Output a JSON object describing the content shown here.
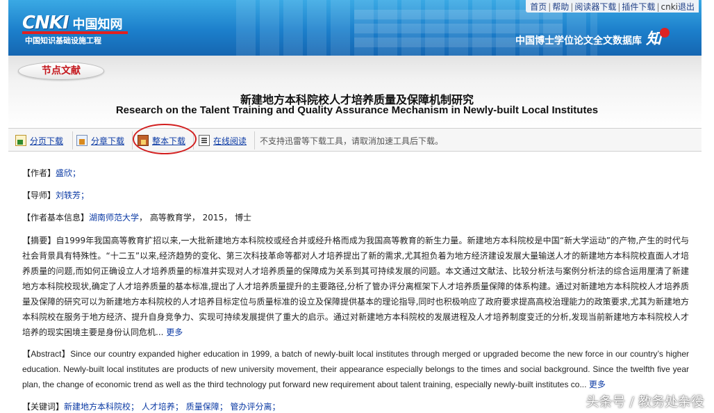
{
  "top_nav": {
    "items": [
      "首页",
      "帮助",
      "阅读器下载",
      "插件下载"
    ],
    "user": "cnki",
    "logout": "退出"
  },
  "logo": {
    "brand": "CNKI",
    "cn_name": "中国知网",
    "tagline": "中国知识基础设施工程"
  },
  "database_name": "中国博士学位论文全文数据库",
  "brand_mark": "知",
  "section_label": "节点文献",
  "title_cn": "新建地方本科院校人才培养质量及保障机制研究",
  "title_en": "Research on the Talent Training and Quality Assurance Mechanism in Newly-built Local Institutes",
  "toolbar": {
    "page_download": "分页下载",
    "chapter_download": "分章下载",
    "whole_download": "整本下载",
    "online_read": "在线阅读",
    "note": "不支持迅雷等下载工具，请取消加速工具后下载。"
  },
  "fields": {
    "author_label": "【作者】",
    "author": "盛欣；",
    "advisor_label": "【导师】",
    "advisor": "刘轶芳；",
    "info_label": "【作者基本信息】",
    "institution": "湖南师范大学",
    "info_rest": "， 高等教育学， 2015， 博士"
  },
  "abstract_cn": {
    "label": "【摘要】",
    "text": "自1999年我国高等教育扩招以来,一大批新建地方本科院校或经合并或经升格而成为我国高等教育的新生力量。新建地方本科院校是中国“新大学运动”的产物,产生的时代与社会背景具有特殊性。“十二五”以来,经济趋势的变化、第三次科技革命等都对人才培养提出了新的需求,尤其担负着为地方经济建设发展大量输送人才的新建地方本科院校直面人才培养质量的问题,而如何正确设立人才培养质量的标准并实现对人才培养质量的保障成为关系到其可持续发展的问题。本文通过文献法、比较分析法与案例分析法的综合运用厘清了新建地方本科院校现状,确定了人才培养质量的基本标准,提出了人才培养质量提升的主要路径,分析了管办评分离框架下人才培养质量保障的体系构建。通过对新建地方本科院校人才培养质量及保障的研究可以为新建地方本科院校的人才培养目标定位与质量标准的设立及保障提供基本的理论指导,同时也积极响应了政府要求提高高校治理能力的政策要求,尤其为新建地方本科院校在服务于地方经济、提升自身竞争力、实现可持续发展提供了重大的启示。通过对新建地方本科院校的发展进程及人才培养制度变迁的分析,发现当前新建地方本科院校人才培养的现实困境主要是身份认同危机...",
    "more": "更多"
  },
  "abstract_en": {
    "label": "【Abstract】",
    "text": "Since our country expanded higher education in 1999, a batch of newly-built local institutes through merged or upgraded become the new force in our country’s higher education. Newly-built local institutes are products of new university movement, their appearance especially belongs to the times and social background. Since the twelfth five year plan, the change of economic trend as well as the third technology put forward new requirement about talent training, especially newly-built institutes co...",
    "more": "更多"
  },
  "keywords": {
    "label": "【关键词】",
    "items": [
      "新建地方本科院校；",
      "人才培养；",
      "质量保障；",
      "管办评分离；"
    ]
  },
  "watermark": "头条号 / 教务处杂役",
  "colors": {
    "banner": "#1c7fcb",
    "link": "#0b3aa4",
    "section_label": "#c4161c",
    "highlight_ring": "#d21f1f"
  }
}
